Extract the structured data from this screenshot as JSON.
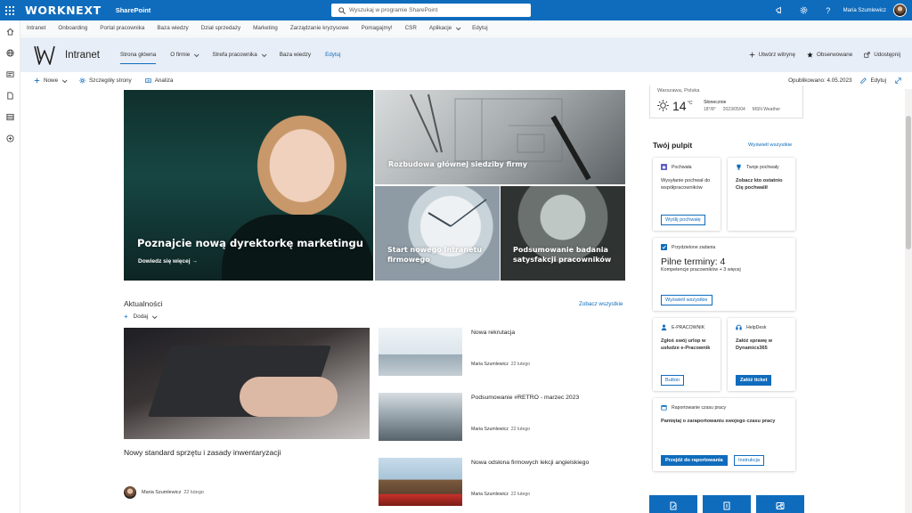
{
  "suite": {
    "brand": "WORKNEXT",
    "app": "SharePoint",
    "search_placeholder": "Wyszukaj w programie SharePoint",
    "user_name": "Maria Szumlewicz"
  },
  "hub_nav": [
    {
      "label": "Intranet",
      "dropdown": false
    },
    {
      "label": "Onboarding",
      "dropdown": false
    },
    {
      "label": "Portal pracownika",
      "dropdown": false
    },
    {
      "label": "Baza wiedzy",
      "dropdown": false
    },
    {
      "label": "Dział sprzedaży",
      "dropdown": false
    },
    {
      "label": "Marketing",
      "dropdown": false
    },
    {
      "label": "Zarządzanie kryzysowe",
      "dropdown": false
    },
    {
      "label": "Pomagajmy!",
      "dropdown": false
    },
    {
      "label": "CSR",
      "dropdown": false
    },
    {
      "label": "Aplikacje",
      "dropdown": true
    },
    {
      "label": "Edytuj",
      "dropdown": false
    }
  ],
  "site": {
    "title": "Intranet",
    "nav": [
      {
        "label": "Strona główna",
        "dropdown": false
      },
      {
        "label": "O firmie",
        "dropdown": true
      },
      {
        "label": "Strefa pracownika",
        "dropdown": true
      },
      {
        "label": "Baza wiedzy",
        "dropdown": false
      },
      {
        "label": "Edytuj",
        "dropdown": false
      }
    ],
    "actions": {
      "create": "Utwórz witrynę",
      "follow": "Obserwowane",
      "share": "Udostępnij"
    }
  },
  "command_bar": {
    "new": "Nowe",
    "details": "Szczegóły strony",
    "analytics": "Analiza",
    "published": "Opublikowano: 4.05.2023",
    "edit": "Edytuj"
  },
  "hero": {
    "main_title": "Poznajcie nową dyrektorkę marketingu",
    "main_link": "Dowiedz się więcej",
    "tile2_title": "Rozbudowa głównej siedziby firmy",
    "tile3_title": "Start nowego Intranetu firmowego",
    "tile4_title": "Podsumowanie badania satysfakcji pracowników"
  },
  "news": {
    "title": "Aktualności",
    "see_all": "Zobacz wszystkie",
    "add": "Dodaj",
    "main": {
      "title": "Nowy standard sprzętu i zasady inwentaryzacji",
      "author": "Maria Szumlewicz",
      "date": "22 lutego"
    },
    "items": [
      {
        "title": "Nowa rekrutacja",
        "author": "Maria Szumlewicz",
        "date": "22 lutego"
      },
      {
        "title": "Podsumowanie #RETRO - marzec 2023",
        "author": "Maria Szumlewicz",
        "date": "22 lutego"
      },
      {
        "title": "Nowa odsłona firmowych lekcji angielskiego",
        "author": "Maria Szumlewicz",
        "date": "22 lutego"
      }
    ]
  },
  "weather": {
    "location": "Warszawa, Polska",
    "temp": "14",
    "unit": "°C",
    "condition": "Słonecznie",
    "range": "18°/8°",
    "date": "2023/05/04",
    "source": "MSN Weather"
  },
  "dashboard": {
    "title": "Twój pulpit",
    "see_all": "Wyświetl wszystkie",
    "praise": {
      "head": "Pochwała",
      "body": "Wysyłanie pochwał do współpracowników",
      "button": "Wyślij pochwałę"
    },
    "your_praise": {
      "head": "Twoje pochwały",
      "body": "Zobacz kto ostatnio Cię pochwalił"
    },
    "tasks": {
      "head": "Przydzielone zadania",
      "deadline": "Pilne terminy: 4",
      "sub": "Kompetencje pracowników + 3 więcej",
      "button": "Wyświetl wszystkie"
    },
    "epracownik": {
      "head": "E-PRACOWNIK",
      "body": "Zgłoś swój urlop w usłudze e-Pracownik",
      "button": "Button"
    },
    "helpdesk": {
      "head": "HelpDesk",
      "body": "Załóż sprawę w Dynamics365",
      "button": "Załóż ticket"
    },
    "timereport": {
      "head": "Raportowanie czasu pracy",
      "body": "Pamiętaj o zaraportowaniu swojego czasu pracy",
      "button1": "Przejdź do raportowania",
      "button2": "Instrukcja"
    }
  },
  "colors": {
    "accent": "#0f6cbd",
    "header_bg": "#e8eef7"
  }
}
